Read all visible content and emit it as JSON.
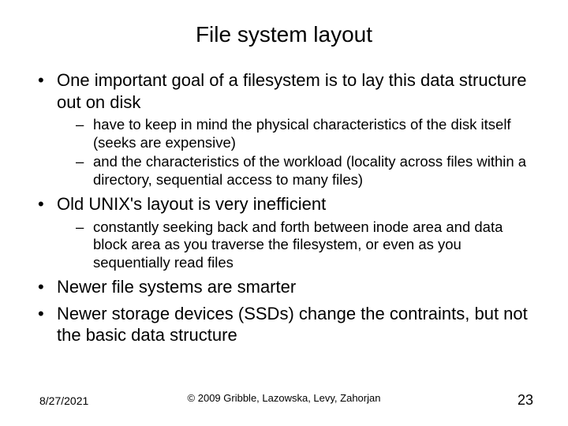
{
  "title": "File system layout",
  "bullets": [
    {
      "text": "One important goal of a filesystem is to lay this data structure out on disk",
      "sub": [
        "have to keep in mind the physical characteristics of the disk itself  (seeks are expensive)",
        "and the characteristics of the workload  (locality across files within a directory, sequential access to many files)"
      ]
    },
    {
      "text": "Old UNIX's layout is very inefficient",
      "sub": [
        "constantly seeking back and forth between inode area and data block area as you traverse the filesystem, or even as you sequentially read files"
      ]
    },
    {
      "text": "Newer file systems are smarter",
      "sub": []
    },
    {
      "text": "Newer storage devices (SSDs) change the contraints, but not the basic data structure",
      "sub": []
    }
  ],
  "footer": {
    "date": "8/27/2021",
    "copyright": "© 2009 Gribble, Lazowska, Levy, Zahorjan",
    "page": "23"
  }
}
